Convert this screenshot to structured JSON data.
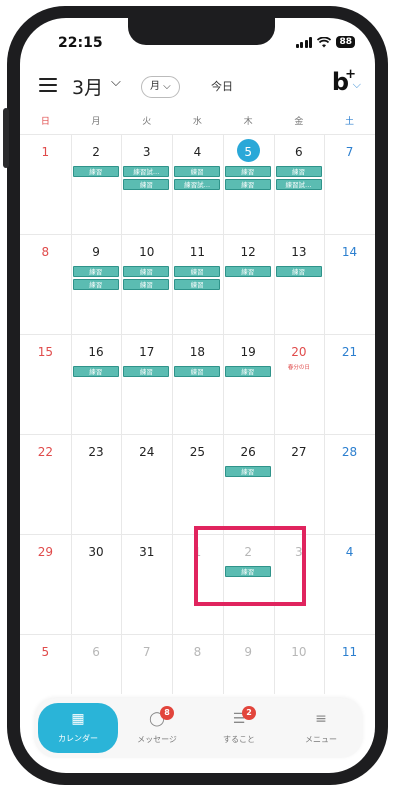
{
  "status": {
    "time": "22:15",
    "battery": "88"
  },
  "header": {
    "month": "3月",
    "view": "月",
    "today": "今日",
    "brand": "b",
    "brand_plus": "+"
  },
  "weekdays": [
    "日",
    "月",
    "火",
    "水",
    "木",
    "金",
    "土"
  ],
  "weeks": [
    {
      "days": [
        {
          "n": "1",
          "sun": true
        },
        {
          "n": "2",
          "events": [
            "練習",
            ""
          ]
        },
        {
          "n": "3",
          "events": [
            "練習試…",
            "練習"
          ]
        },
        {
          "n": "4",
          "events": [
            "練習",
            "練習試…"
          ]
        },
        {
          "n": "5",
          "today": true,
          "events": [
            "練習",
            "練習"
          ]
        },
        {
          "n": "6",
          "events": [
            "練習",
            "練習試…"
          ]
        },
        {
          "n": "7",
          "sat": true
        }
      ]
    },
    {
      "days": [
        {
          "n": "8",
          "sun": true
        },
        {
          "n": "9",
          "events": [
            "練習",
            "練習"
          ]
        },
        {
          "n": "10",
          "events": [
            "練習",
            "練習"
          ]
        },
        {
          "n": "11",
          "events": [
            "練習",
            "練習"
          ]
        },
        {
          "n": "12",
          "events": [
            "練習"
          ]
        },
        {
          "n": "13",
          "events": [
            "練習"
          ]
        },
        {
          "n": "14",
          "sat": true
        }
      ]
    },
    {
      "days": [
        {
          "n": "15",
          "sun": true
        },
        {
          "n": "16",
          "events": [
            "練習"
          ]
        },
        {
          "n": "17",
          "events": [
            "練習"
          ]
        },
        {
          "n": "18",
          "events": [
            "練習"
          ]
        },
        {
          "n": "19",
          "events": [
            "練習"
          ]
        },
        {
          "n": "20",
          "holiday_day": true,
          "holiday": "春分の日"
        },
        {
          "n": "21",
          "sat": true
        }
      ]
    },
    {
      "days": [
        {
          "n": "22",
          "sun": true
        },
        {
          "n": "23"
        },
        {
          "n": "24"
        },
        {
          "n": "25"
        },
        {
          "n": "26",
          "events": [
            "練習"
          ]
        },
        {
          "n": "27"
        },
        {
          "n": "28",
          "sat": true
        }
      ]
    },
    {
      "days": [
        {
          "n": "29",
          "sun": true
        },
        {
          "n": "30"
        },
        {
          "n": "31"
        },
        {
          "n": "1",
          "other": true
        },
        {
          "n": "2",
          "other": true,
          "events": [
            "練習"
          ]
        },
        {
          "n": "3",
          "other": true
        },
        {
          "n": "4",
          "sat": true
        }
      ]
    },
    {
      "days": [
        {
          "n": "5",
          "sun": true,
          "other": true
        },
        {
          "n": "6",
          "other": true
        },
        {
          "n": "7",
          "other": true
        },
        {
          "n": "8",
          "other": true
        },
        {
          "n": "9",
          "other": true
        },
        {
          "n": "10",
          "other": true
        },
        {
          "n": "11",
          "sat": true,
          "other": true
        }
      ]
    }
  ],
  "tabs": [
    {
      "label": "カレンダー",
      "icon": "calendar-icon",
      "active": true
    },
    {
      "label": "メッセージ",
      "icon": "chat-bubble-icon",
      "badge": "8"
    },
    {
      "label": "すること",
      "icon": "checklist-icon",
      "badge": "2"
    },
    {
      "label": "メニュー",
      "icon": "menu-lines-icon"
    }
  ],
  "colors": {
    "event_bg": "#5bbcb2",
    "accent": "#2ab4d8",
    "sunday": "#e04b4b",
    "saturday": "#2c7fcf",
    "highlight": "#e0245e",
    "badge": "#e2453c"
  }
}
